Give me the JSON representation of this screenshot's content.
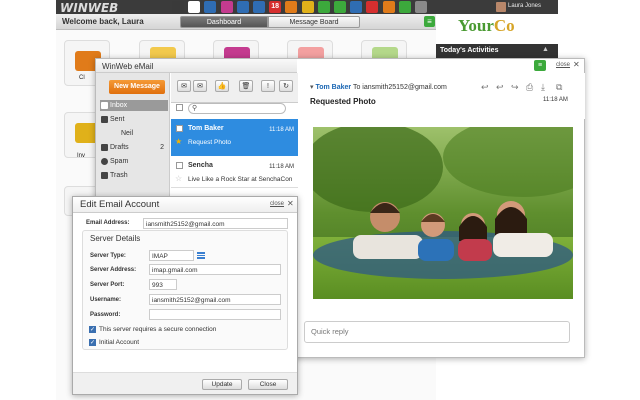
{
  "topbar": {
    "logo": "WINWEB",
    "user_name": "Laura Jones",
    "icons": [
      {
        "name": "people-icon",
        "color": "#3a3a3a"
      },
      {
        "name": "home-icon",
        "color": "#ffffff"
      },
      {
        "name": "briefcase-icon",
        "color": "#2f6db3"
      },
      {
        "name": "presentation-icon",
        "color": "#c43b8f"
      },
      {
        "name": "email-icon",
        "color": "#2f6db3"
      },
      {
        "name": "table-icon",
        "color": "#2f6db3"
      },
      {
        "name": "calendar-icon",
        "color": "#d62f2f"
      },
      {
        "name": "contacts-icon",
        "color": "#e07b1a"
      },
      {
        "name": "invoice-icon",
        "color": "#e0b11a"
      },
      {
        "name": "chart-icon",
        "color": "#3ca93c"
      },
      {
        "name": "grid-icon",
        "color": "#3ca93c"
      },
      {
        "name": "tasks-icon",
        "color": "#2f6db3"
      },
      {
        "name": "contacts-list-icon",
        "color": "#d62f2f"
      },
      {
        "name": "cloud-icon",
        "color": "#e07b1a"
      },
      {
        "name": "store-icon",
        "color": "#3ca93c"
      },
      {
        "name": "gear-icon",
        "color": "#8a8a8a"
      }
    ],
    "calendar_day": "18"
  },
  "subbar": {
    "welcome": "Welcome back, Laura",
    "tabs": [
      "Dashboard",
      "Message Board"
    ]
  },
  "right_panel": {
    "brand_a": "Your",
    "brand_b": "Co",
    "activities_title": "Today's Activities"
  },
  "tiles": [
    {
      "label": "Cl",
      "color": "#e07b1a"
    },
    {
      "label": "Inv",
      "color": "#e0b11a"
    }
  ],
  "email": {
    "title": "WinWeb eMail",
    "close_label": "close",
    "new_message": "New Message",
    "nav": [
      {
        "label": "Inbox",
        "count": "",
        "selected": true
      },
      {
        "label": "Sent",
        "count": ""
      },
      {
        "label": "Neil",
        "count": ""
      },
      {
        "label": "Drafts",
        "count": "2"
      },
      {
        "label": "Spam",
        "count": ""
      },
      {
        "label": "Trash",
        "count": ""
      }
    ],
    "messages": [
      {
        "from": "Tom Baker",
        "time": "11:18 AM",
        "subject": "Request Photo",
        "selected": true
      },
      {
        "from": "Sencha",
        "time": "11:18 AM",
        "subject": "Live Like a Rock Star at SenchaCon",
        "selected": false
      }
    ],
    "reader": {
      "from": "Tom Baker",
      "to_text": "To iansmith25152@gmail.com",
      "time": "11:18 AM",
      "subject": "Requested Photo",
      "quick_reply_placeholder": "Quick reply"
    }
  },
  "edit_dialog": {
    "title": "Edit Email Account",
    "close_label": "close",
    "email_label": "Email Address:",
    "email_value": "iansmith25152@gmail.com",
    "server_details": "Server Details",
    "fields": [
      {
        "label": "Server Type:",
        "value": "IMAP"
      },
      {
        "label": "Server Address:",
        "value": "imap.gmail.com"
      },
      {
        "label": "Server Port:",
        "value": "993"
      },
      {
        "label": "Username:",
        "value": "iansmith25152@gmail.com"
      },
      {
        "label": "Password:",
        "value": ""
      }
    ],
    "checkboxes": [
      {
        "label": "This server requires a secure connection",
        "checked": true
      },
      {
        "label": "Initial Account",
        "checked": true
      }
    ],
    "update_button": "Update",
    "close_button": "Close"
  }
}
